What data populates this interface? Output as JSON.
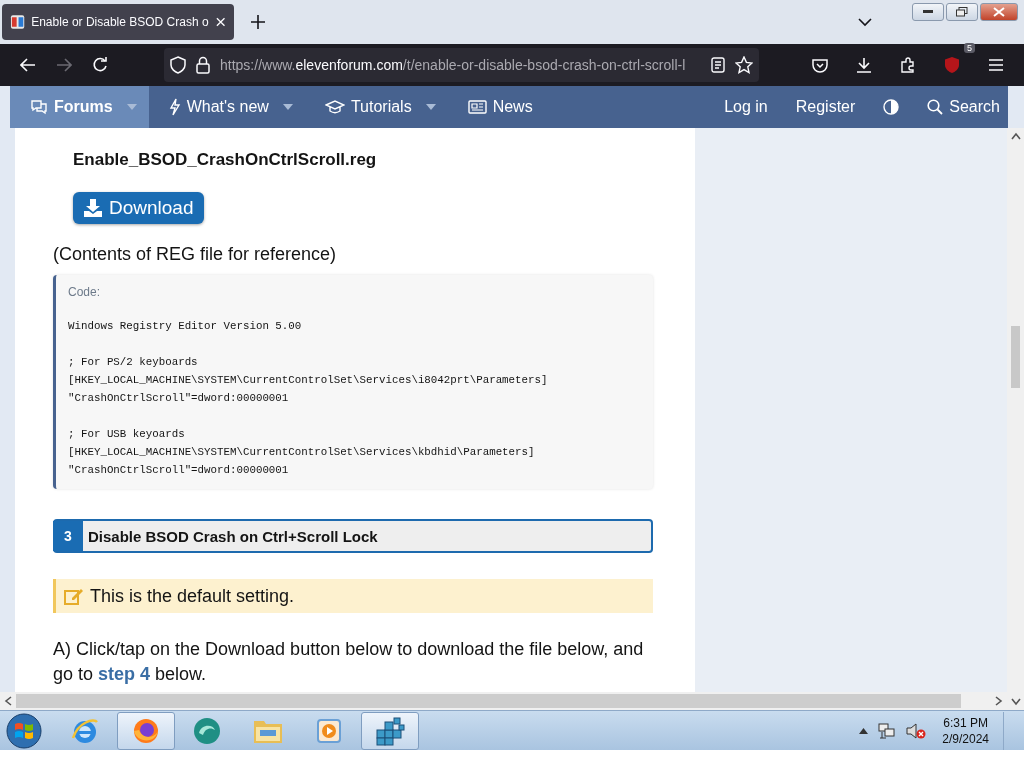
{
  "browser": {
    "tab_title": "Enable or Disable BSOD Crash o",
    "url_prefix": "https://www.",
    "url_domain": "elevenforum.com",
    "url_path": "/t/enable-or-disable-bsod-crash-on-ctrl-scroll-l",
    "extension_badge": "5"
  },
  "site_nav": {
    "items": [
      {
        "label": "Forums",
        "selected": true,
        "has_menu": true,
        "kind": "chat"
      },
      {
        "label": "What's new",
        "selected": false,
        "has_menu": true,
        "kind": "bolt"
      },
      {
        "label": "Tutorials",
        "selected": false,
        "has_menu": true,
        "kind": "cap"
      },
      {
        "label": "News",
        "selected": false,
        "has_menu": false,
        "kind": "paper"
      }
    ],
    "login": "Log in",
    "register": "Register",
    "search": "Search"
  },
  "article": {
    "file_name": "Enable_BSOD_CrashOnCtrlScroll.reg",
    "download_button": "Download",
    "contents_note": "(Contents of REG file for reference)",
    "code": {
      "label": "Code:",
      "blocks": [
        [
          "Windows Registry Editor Version 5.00"
        ],
        [
          "; For PS/2 keyboards",
          "[HKEY_LOCAL_MACHINE\\SYSTEM\\CurrentControlSet\\Services\\i8042prt\\Parameters]",
          "\"CrashOnCtrlScroll\"=dword:00000001"
        ],
        [
          "; For USB keyoards",
          "[HKEY_LOCAL_MACHINE\\SYSTEM\\CurrentControlSet\\Services\\kbdhid\\Parameters]",
          "\"CrashOnCtrlScroll\"=dword:00000001"
        ]
      ]
    },
    "step": {
      "number": "3",
      "title": "Disable BSOD Crash on Ctrl+Scroll Lock"
    },
    "note": "This is the default setting.",
    "paragraph": {
      "before": "A) Click/tap on the Download button below to download the file below, and go to ",
      "link": "step 4",
      "after": " below."
    }
  },
  "taskbar": {
    "apps": [
      {
        "kind": "e",
        "selected": false
      },
      {
        "kind": "fox",
        "selected": true
      },
      {
        "kind": "swirl",
        "selected": false
      },
      {
        "kind": "folder",
        "selected": false
      },
      {
        "kind": "play",
        "selected": false
      },
      {
        "kind": "cubes",
        "selected": true
      }
    ],
    "time": "6:31 PM",
    "date": "2/9/2024"
  }
}
